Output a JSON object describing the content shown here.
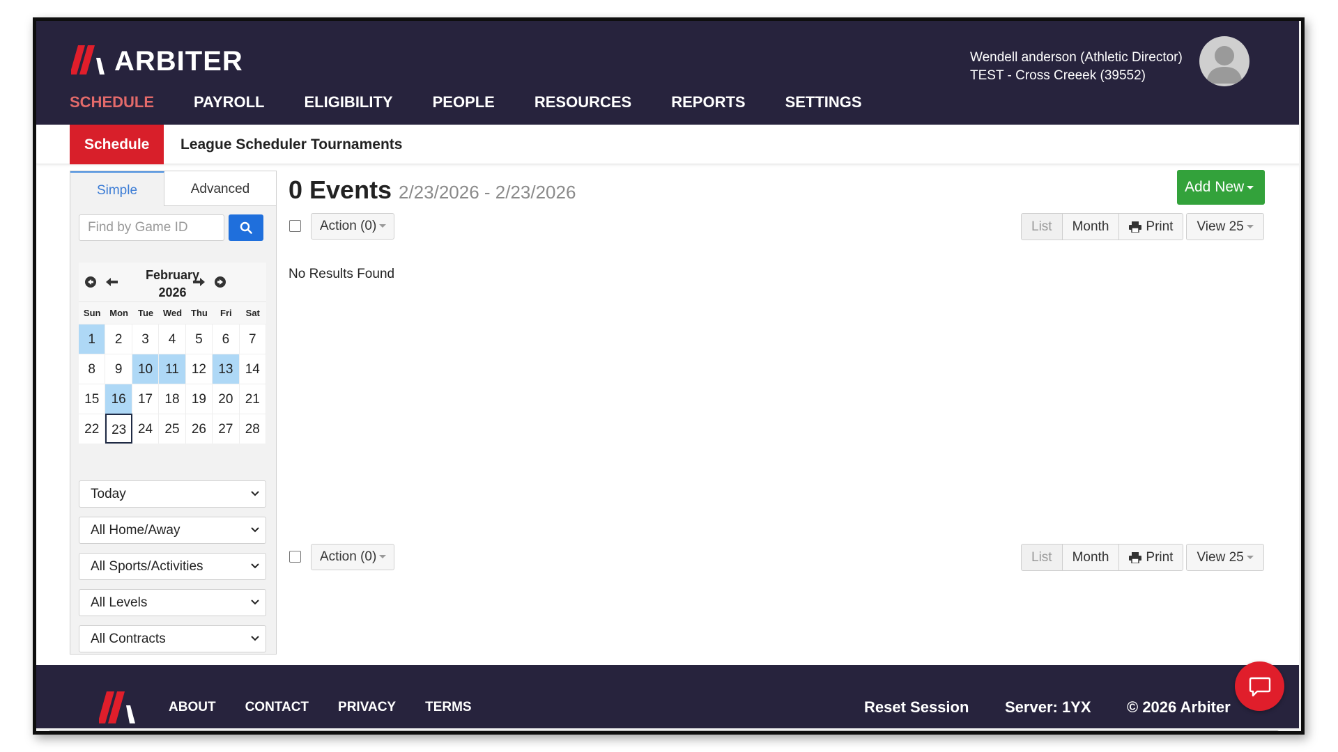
{
  "header": {
    "brand": "ARBITER",
    "nav": [
      "SCHEDULE",
      "PAYROLL",
      "ELIGIBILITY",
      "PEOPLE",
      "RESOURCES",
      "REPORTS",
      "SETTINGS"
    ],
    "user_name": "Wendell anderson (Athletic Director)",
    "org": "TEST - Cross Creeek (39552)"
  },
  "subnav": {
    "tabs": [
      "Schedule",
      "League Scheduler",
      "Tournaments"
    ]
  },
  "sidebar": {
    "tab_simple": "Simple",
    "tab_advanced": "Advanced",
    "search_placeholder": "Find by Game ID",
    "calendar": {
      "month": "February",
      "year": "2026",
      "dow": [
        "Sun",
        "Mon",
        "Tue",
        "Wed",
        "Thu",
        "Fri",
        "Sat"
      ],
      "days": [
        "1",
        "2",
        "3",
        "4",
        "5",
        "6",
        "7",
        "8",
        "9",
        "10",
        "11",
        "12",
        "13",
        "14",
        "15",
        "16",
        "17",
        "18",
        "19",
        "20",
        "21",
        "22",
        "23",
        "24",
        "25",
        "26",
        "27",
        "28"
      ],
      "highlighted": [
        1,
        10,
        11,
        13,
        16
      ],
      "today": 23
    },
    "filters": [
      "Today",
      "All Home/Away",
      "All Sports/Activities",
      "All Levels",
      "All Contracts"
    ]
  },
  "main": {
    "title": "0 Events",
    "date_range": "2/23/2026 - 2/23/2026",
    "add_new": "Add New",
    "action": "Action (0)",
    "view_list": "List",
    "view_month": "Month",
    "print": "Print",
    "view_count": "View 25",
    "no_results": "No Results Found"
  },
  "footer": {
    "links": [
      "ABOUT",
      "CONTACT",
      "PRIVACY",
      "TERMS"
    ],
    "reset": "Reset Session",
    "server": "Server: 1YX",
    "copyright": "© 2026 Arbiter"
  },
  "colors": {
    "header_bg": "#27233d",
    "accent_red": "#d81f2a",
    "nav_active": "#e36a6a",
    "calendar_highlight": "#aed8f6",
    "add_green": "#33a23b",
    "search_blue": "#1f6fdc"
  }
}
